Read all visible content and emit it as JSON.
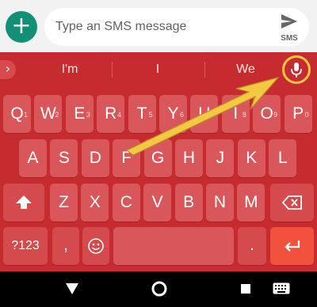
{
  "compose": {
    "placeholder": "Type an SMS message",
    "send_label": "SMS",
    "add_icon": "plus-icon",
    "send_icon": "send-icon"
  },
  "keyboard": {
    "suggestions": [
      "I'm",
      "I",
      "We"
    ],
    "mic_icon": "microphone-icon",
    "row1": [
      {
        "k": "Q",
        "h": "1"
      },
      {
        "k": "W",
        "h": "2"
      },
      {
        "k": "E",
        "h": "3"
      },
      {
        "k": "R",
        "h": "4"
      },
      {
        "k": "T",
        "h": "5"
      },
      {
        "k": "Y",
        "h": "6"
      },
      {
        "k": "U",
        "h": "7"
      },
      {
        "k": "I",
        "h": "8"
      },
      {
        "k": "O",
        "h": "9"
      },
      {
        "k": "P",
        "h": "0"
      }
    ],
    "row2": [
      "A",
      "S",
      "D",
      "F",
      "G",
      "H",
      "J",
      "K",
      "L"
    ],
    "row3": [
      "Z",
      "X",
      "C",
      "V",
      "B",
      "N",
      "M"
    ],
    "symbols_label": "?123",
    "comma_label": ",",
    "period_label": ".",
    "emoji_icon": "smiley-icon",
    "shift_icon": "shift-icon",
    "backspace_icon": "backspace-icon",
    "enter_icon": "enter-icon"
  },
  "navbar": {
    "back_icon": "back-triangle-icon",
    "home_icon": "home-circle-icon",
    "recents_icon": "recents-square-icon",
    "keyboard_icon": "keyboard-switch-icon"
  },
  "colors": {
    "keyboard_bg": "#c62c2f",
    "key_bg": "#d9575a",
    "enter_bg": "#f2513d",
    "fab": "#138f76",
    "annotation": "#f5c842"
  }
}
